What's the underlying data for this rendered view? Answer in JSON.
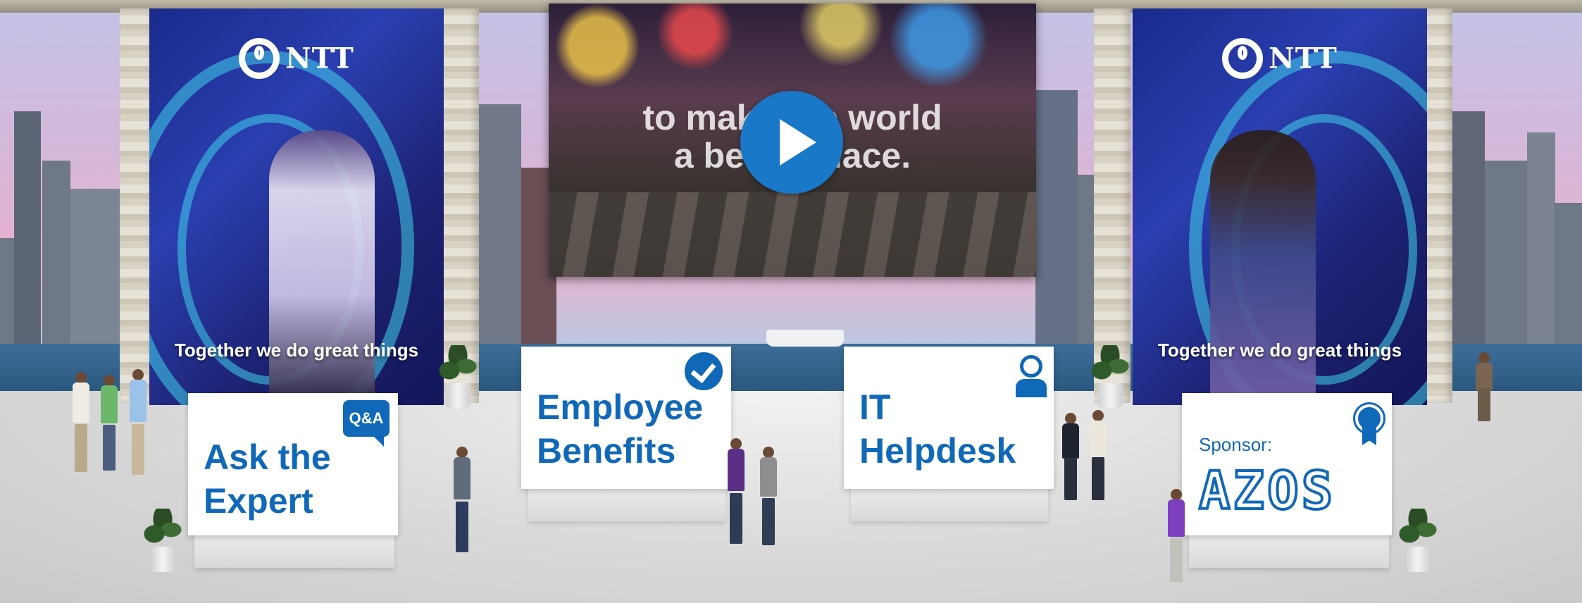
{
  "scene": {
    "banner_left": {
      "logo_text": "NTT",
      "tagline": "Together we do great things"
    },
    "banner_right": {
      "logo_text": "NTT",
      "tagline": "Together we do great things"
    },
    "video": {
      "overlay_line1": "to make the world",
      "overlay_line2": "a better place."
    }
  },
  "signs": {
    "ask_expert": {
      "line1": "Ask the",
      "line2": "Expert",
      "icon_text": "Q&A",
      "icon": "qa-bubble-icon"
    },
    "employee_benefits": {
      "line1": "Employee",
      "line2": "Benefits",
      "icon": "check-circle-icon"
    },
    "it_helpdesk": {
      "line1": "IT",
      "line2": "Helpdesk",
      "icon": "headset-user-icon"
    },
    "sponsor": {
      "label": "Sponsor:",
      "logo_text": "AZOS",
      "icon": "award-ribbon-icon"
    }
  },
  "colors": {
    "brand_blue": "#1068b8",
    "play_button": "#1a78c8"
  }
}
